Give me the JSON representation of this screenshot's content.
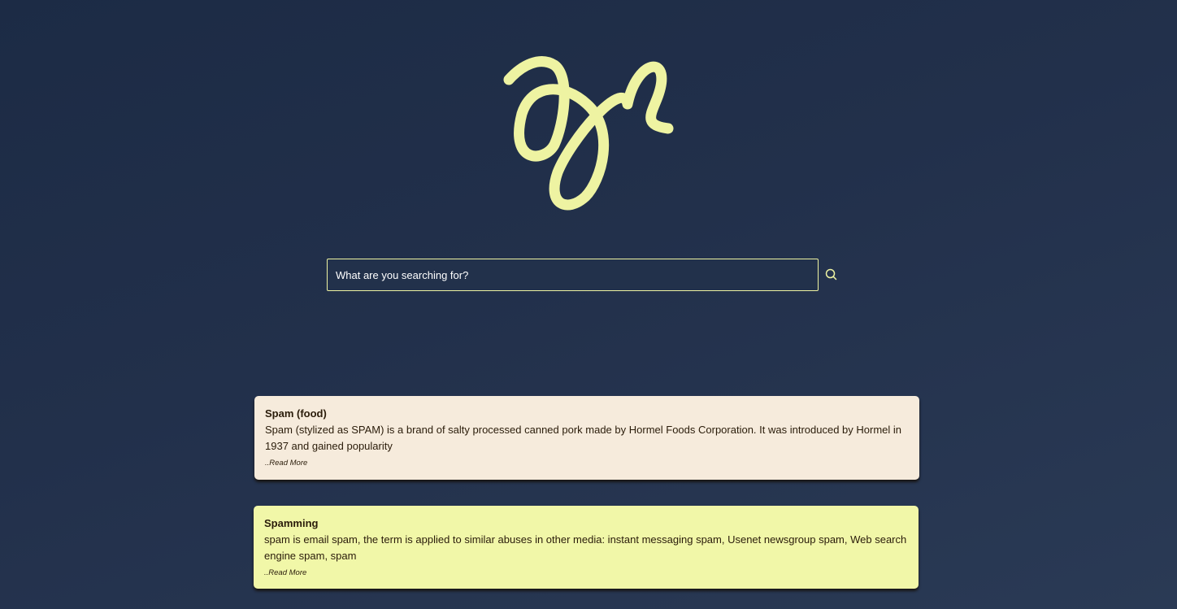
{
  "search": {
    "placeholder": "What are you searching for?",
    "value": "",
    "icon": "search-icon"
  },
  "logo": {
    "icon": "squiggle-logo-icon",
    "color": "#eef3a2"
  },
  "theme": {
    "accent": "#eef3a2",
    "background": "#1f2e48",
    "card_1_bg": "#f6ebdc",
    "card_2_bg": "#f1f7a8",
    "text_dark": "#2a1c0a"
  },
  "results": [
    {
      "title": "Spam (food)",
      "snippet": "Spam (stylized as SPAM) is a brand of salty processed canned pork made by Hormel Foods Corporation. It was introduced by Hormel in 1937 and gained popularity",
      "read_more": "..Read More"
    },
    {
      "title": "Spamming",
      "snippet": "spam is email spam, the term is applied to similar abuses in other media: instant messaging spam, Usenet newsgroup spam, Web search engine spam, spam",
      "read_more": "..Read More"
    }
  ]
}
